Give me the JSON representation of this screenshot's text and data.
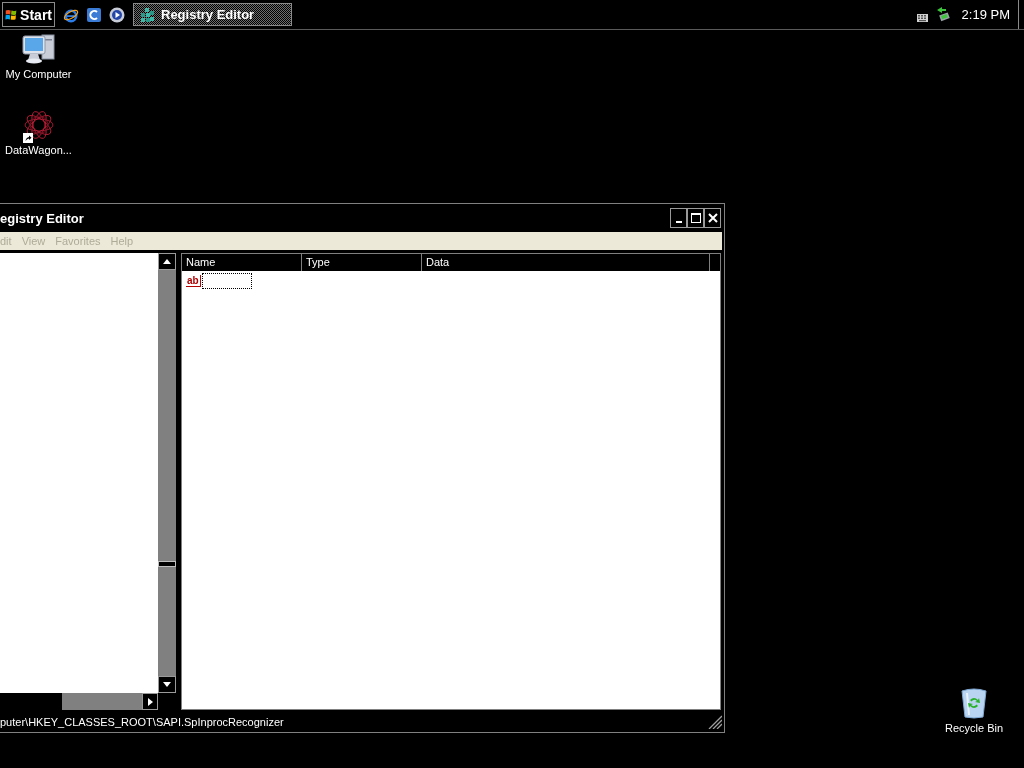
{
  "taskbar": {
    "start_button": {
      "label": "Start"
    },
    "tasks": [
      {
        "label": "Registry Editor",
        "selected": true
      }
    ],
    "clock": "2:19 PM"
  },
  "desktop": {
    "icons": [
      {
        "kind": "computer",
        "label": "My Computer",
        "shortcut": false
      },
      {
        "kind": "program",
        "label": "DataWagon...",
        "shortcut": true
      },
      {
        "kind": "recycle-bin",
        "label": "Recycle Bin",
        "shortcut": false
      }
    ]
  },
  "window": {
    "title": "egistry Editor",
    "menu": [
      {
        "label": "dit",
        "disabled": true
      },
      {
        "label": "View",
        "disabled": true
      },
      {
        "label": "Favorites",
        "disabled": true
      },
      {
        "label": "Help",
        "disabled": true
      }
    ],
    "values_list": {
      "columns": [
        "Name",
        "Type",
        "Data"
      ],
      "rows": [
        {
          "kind": "string",
          "icon_text": "ab",
          "editing": true
        }
      ]
    },
    "status_bar": "puter\\HKEY_CLASSES_ROOT\\SAPI.SpInprocRecognizer"
  }
}
